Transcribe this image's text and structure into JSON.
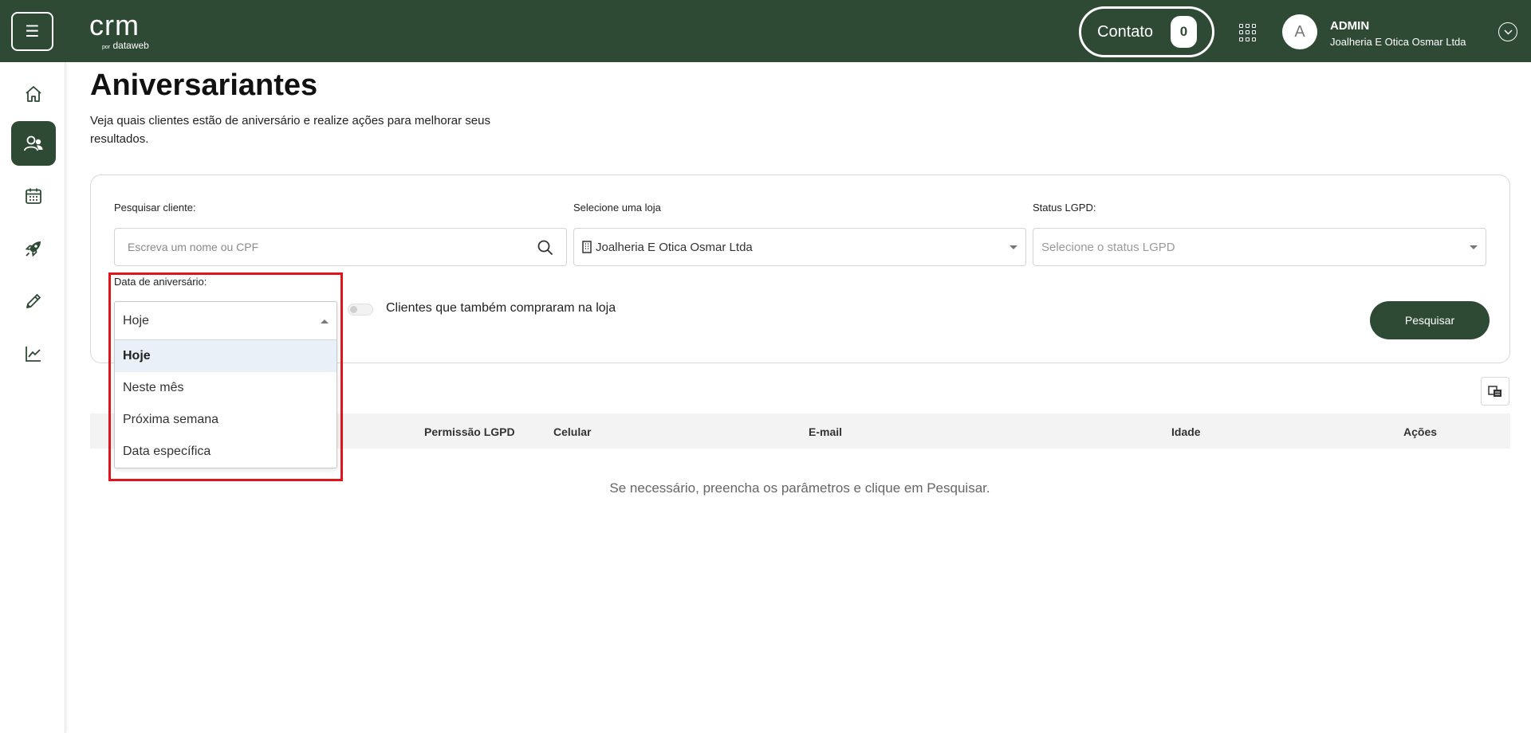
{
  "header": {
    "logo_text": "crm",
    "logo_sub_prefix": "por",
    "logo_sub_brand": "dataweb",
    "contato_label": "Contato",
    "contato_count": "0",
    "avatar_initial": "A",
    "user_name": "ADMIN",
    "user_store": "Joalheria E Otica Osmar Ltda",
    "brand_color": "#2e4a34"
  },
  "sidebar": {
    "items": [
      {
        "icon": "home-icon",
        "active": false
      },
      {
        "icon": "users-icon",
        "active": true
      },
      {
        "icon": "calendar-icon",
        "active": false
      },
      {
        "icon": "rocket-icon",
        "active": false
      },
      {
        "icon": "pencil-icon",
        "active": false
      },
      {
        "icon": "chart-line-icon",
        "active": false
      }
    ]
  },
  "page": {
    "title": "Aniversariantes",
    "description": "Veja quais clientes estão de aniversário e realize ações para melhorar seus resultados."
  },
  "filters": {
    "search_label": "Pesquisar cliente:",
    "search_placeholder": "Escreva um nome ou CPF",
    "store_label": "Selecione uma loja",
    "store_value": "Joalheria E Otica Osmar Ltda",
    "lgpd_label": "Status LGPD:",
    "lgpd_placeholder": "Selecione o status LGPD",
    "date_label": "Data de aniversário:",
    "date_value": "Hoje",
    "date_options": [
      "Hoje",
      "Neste mês",
      "Próxima semana",
      "Data específica"
    ],
    "toggle_label": "Clientes que também compraram na loja",
    "toggle_on": false,
    "search_button": "Pesquisar"
  },
  "table": {
    "columns": [
      "Permissão LGPD",
      "Celular",
      "E-mail",
      "Idade",
      "Ações"
    ],
    "empty_message": "Se necessário, preencha os parâmetros e clique em Pesquisar."
  }
}
